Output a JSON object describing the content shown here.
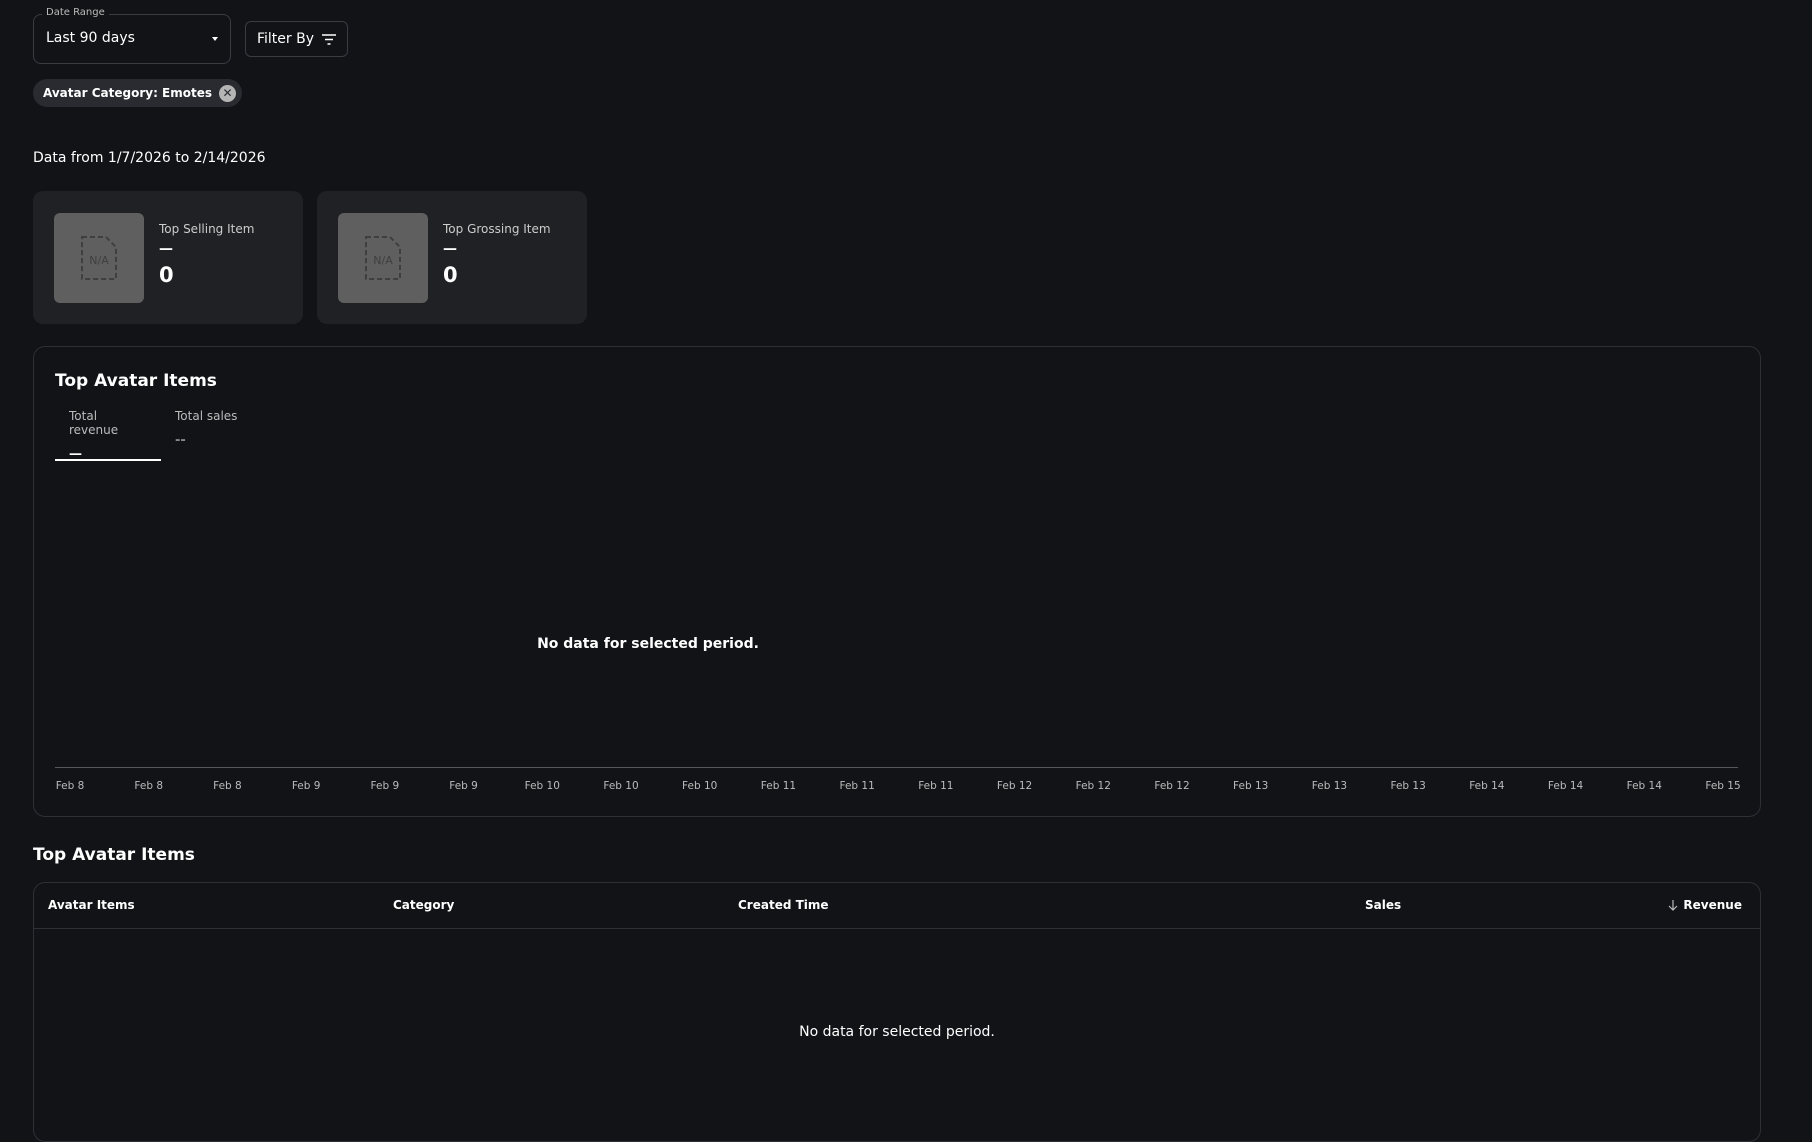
{
  "filters": {
    "date_range_label": "Date Range",
    "date_range_value": "Last 90 days",
    "filter_by_label": "Filter By",
    "active_chip": "Avatar Category: Emotes"
  },
  "date_range_text": "Data from 1/7/2026 to 2/14/2026",
  "cards": [
    {
      "title": "Top Selling Item",
      "name": "—",
      "value": "0",
      "thumb": "N/A"
    },
    {
      "title": "Top Grossing Item",
      "name": "—",
      "value": "0",
      "thumb": "N/A"
    }
  ],
  "chart_panel": {
    "title": "Top Avatar Items",
    "tabs": [
      {
        "label": "Total revenue",
        "value": "—"
      },
      {
        "label": "Total sales",
        "value": "--"
      }
    ],
    "empty_message": "No data for selected period."
  },
  "chart_data": {
    "type": "line",
    "title": "Top Avatar Items",
    "x": [
      "Feb 8",
      "Feb 8",
      "Feb 8",
      "Feb 9",
      "Feb 9",
      "Feb 9",
      "Feb 10",
      "Feb 10",
      "Feb 10",
      "Feb 11",
      "Feb 11",
      "Feb 11",
      "Feb 12",
      "Feb 12",
      "Feb 12",
      "Feb 13",
      "Feb 13",
      "Feb 13",
      "Feb 14",
      "Feb 14",
      "Feb 14",
      "Feb 15"
    ],
    "series": [],
    "grid": false
  },
  "table": {
    "title": "Top Avatar Items",
    "columns": [
      "Avatar Items",
      "Category",
      "Created Time",
      "Sales",
      "Revenue"
    ],
    "sort_column": "Revenue",
    "empty_message": "No data for selected period."
  }
}
